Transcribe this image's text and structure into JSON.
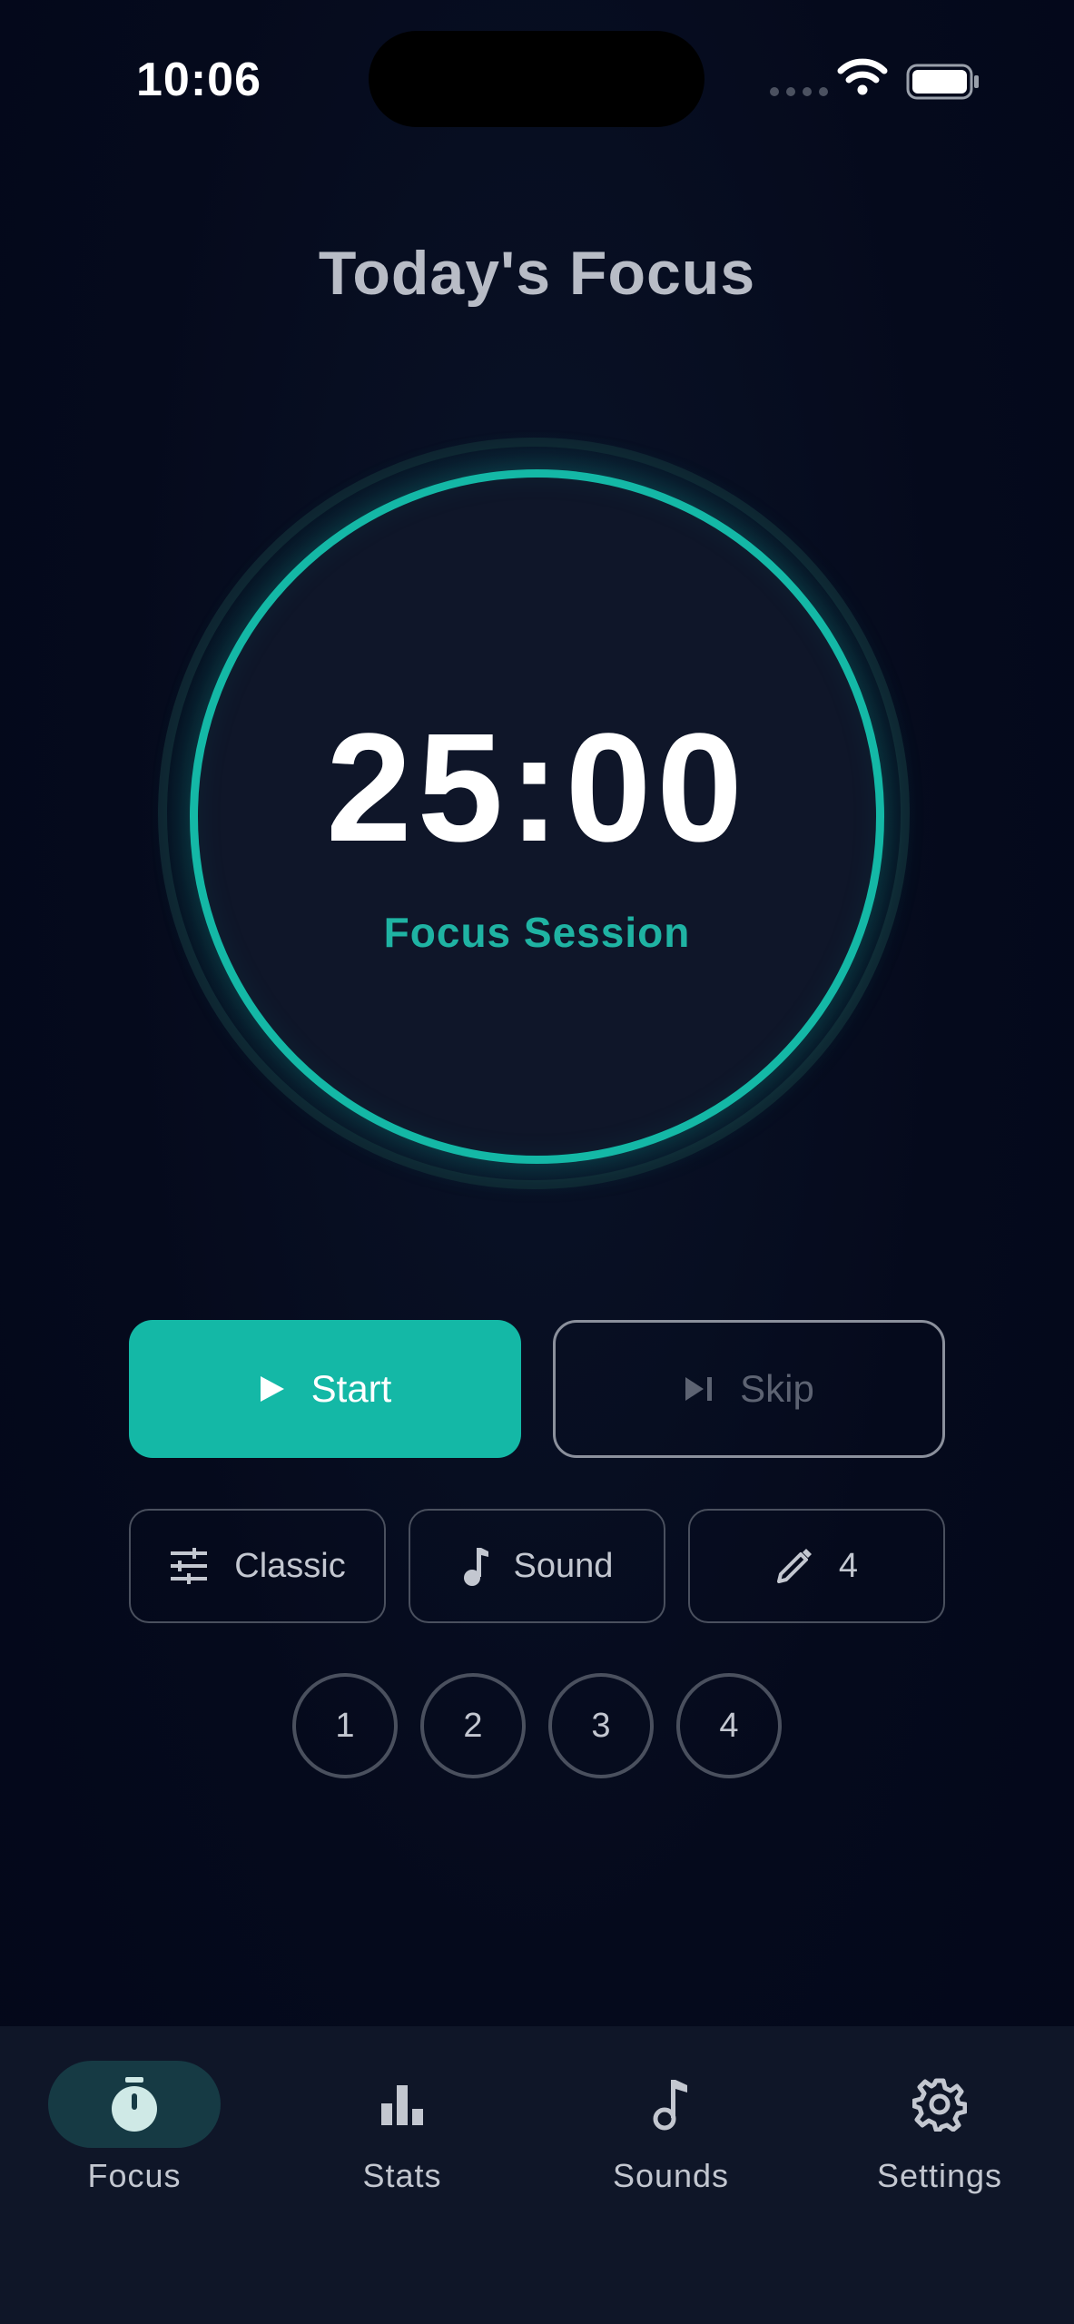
{
  "status_bar": {
    "time": "10:06"
  },
  "header": {
    "title": "Today's Focus"
  },
  "timer": {
    "value": "25:00",
    "label": "Focus Session",
    "progress": 1.0
  },
  "controls": {
    "start_label": "Start",
    "skip_label": "Skip"
  },
  "options": {
    "mode_label": "Classic",
    "sound_label": "Sound",
    "sessions_label": "4"
  },
  "sessions": [
    "1",
    "2",
    "3",
    "4"
  ],
  "nav": {
    "items": [
      {
        "label": "Focus",
        "icon": "timer-icon",
        "active": true
      },
      {
        "label": "Stats",
        "icon": "bar-chart-icon",
        "active": false
      },
      {
        "label": "Sounds",
        "icon": "music-note-icon",
        "active": false
      },
      {
        "label": "Settings",
        "icon": "gear-icon",
        "active": false
      }
    ]
  },
  "colors": {
    "accent": "#14b8a6",
    "background": "#050a1c",
    "nav_background": "#0f1628"
  }
}
